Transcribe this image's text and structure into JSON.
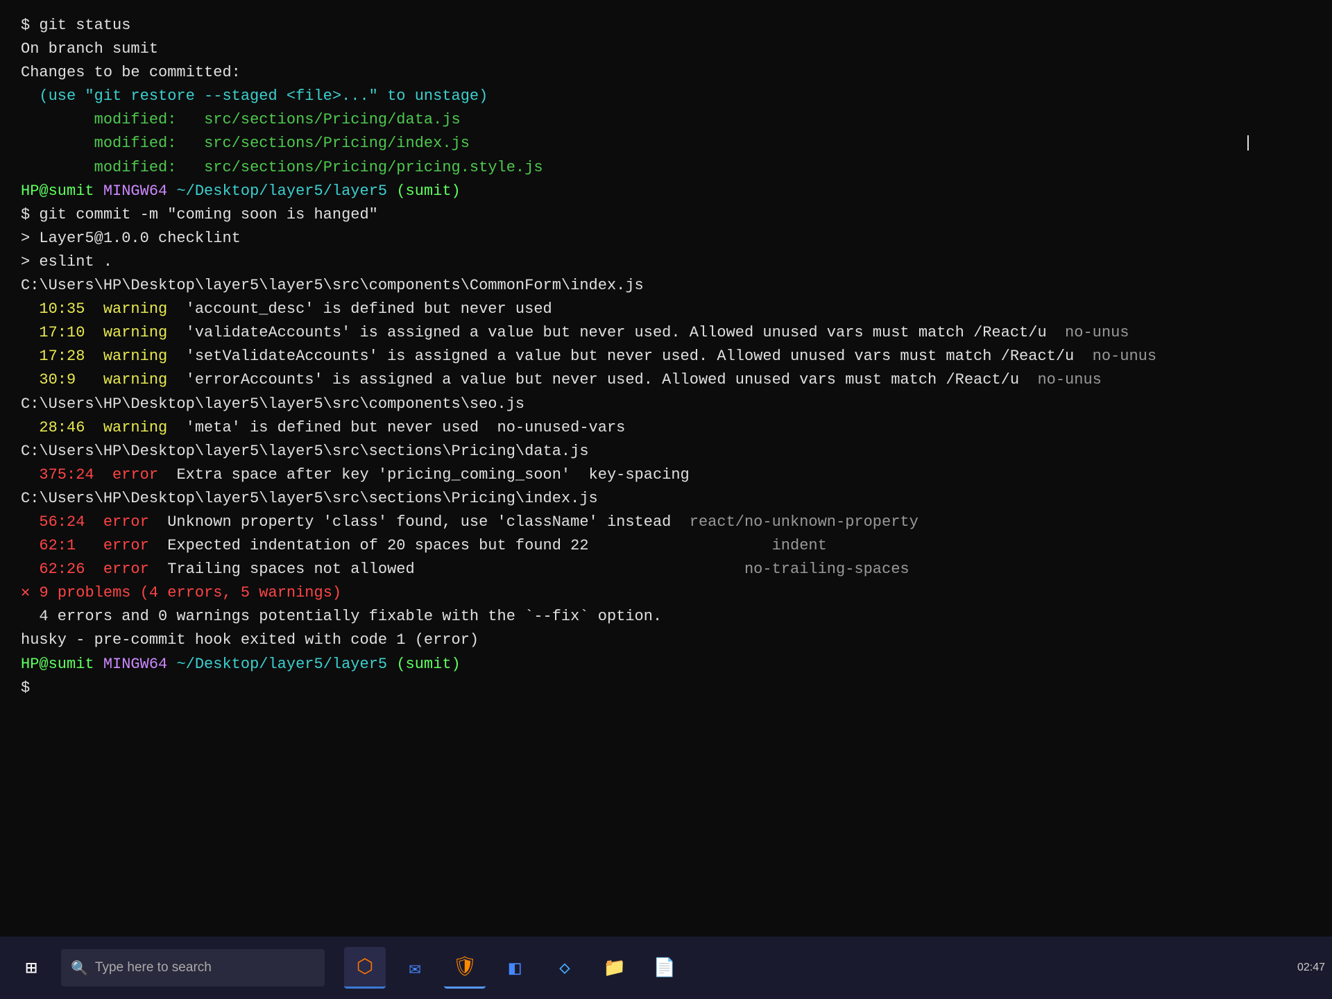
{
  "terminal": {
    "lines": [
      {
        "id": "git-status-cmd",
        "parts": [
          {
            "text": "$ git status",
            "class": "white"
          }
        ]
      },
      {
        "id": "branch-line",
        "parts": [
          {
            "text": "On branch sumit",
            "class": "white"
          }
        ]
      },
      {
        "id": "changes-line",
        "parts": [
          {
            "text": "Changes to be committed:",
            "class": "white"
          }
        ]
      },
      {
        "id": "unstage-hint",
        "parts": [
          {
            "text": "  (use \"git restore --staged <file>...\" to unstage)",
            "class": "cyan"
          }
        ]
      },
      {
        "id": "mod1",
        "parts": [
          {
            "text": "\t",
            "class": ""
          },
          {
            "text": "modified:   ",
            "class": "green"
          },
          {
            "text": "src/sections/Pricing/data.js",
            "class": "green"
          }
        ]
      },
      {
        "id": "mod2",
        "parts": [
          {
            "text": "\t",
            "class": ""
          },
          {
            "text": "modified:   ",
            "class": "green"
          },
          {
            "text": "src/sections/Pricing/index.js",
            "class": "green"
          }
        ]
      },
      {
        "id": "mod3",
        "parts": [
          {
            "text": "\t",
            "class": ""
          },
          {
            "text": "modified:   ",
            "class": "green"
          },
          {
            "text": "src/sections/Pricing/pricing.style.js",
            "class": "green"
          }
        ]
      },
      {
        "id": "blank1",
        "parts": [
          {
            "text": "",
            "class": ""
          }
        ]
      },
      {
        "id": "prompt1",
        "parts": [
          {
            "text": "HP@sumit ",
            "class": "bright-green"
          },
          {
            "text": "MINGW64 ",
            "class": "purple"
          },
          {
            "text": "~/Desktop/layer5/layer5 ",
            "class": "cyan"
          },
          {
            "text": "(sumit)",
            "class": "bright-green"
          }
        ]
      },
      {
        "id": "commit-cmd",
        "parts": [
          {
            "text": "$ git commit -m \"coming soon is hanged\"",
            "class": "white"
          }
        ]
      },
      {
        "id": "blank2",
        "parts": [
          {
            "text": "",
            "class": ""
          }
        ]
      },
      {
        "id": "layer5-checklint",
        "parts": [
          {
            "text": "> Layer5@1.0.0 checklint",
            "class": "white"
          }
        ]
      },
      {
        "id": "eslint-dot",
        "parts": [
          {
            "text": "> eslint .",
            "class": "white"
          }
        ]
      },
      {
        "id": "blank3",
        "parts": [
          {
            "text": "",
            "class": ""
          }
        ]
      },
      {
        "id": "file1",
        "parts": [
          {
            "text": "C:\\Users\\HP\\Desktop\\layer5\\layer5\\src\\components\\CommonForm\\index.js",
            "class": "white"
          }
        ]
      },
      {
        "id": "warn1",
        "parts": [
          {
            "text": "  10:35  warning  ",
            "class": "yellow"
          },
          {
            "text": "'account_desc' is defined but never used",
            "class": "white"
          }
        ]
      },
      {
        "id": "warn2",
        "parts": [
          {
            "text": "  17:10  warning  ",
            "class": "yellow"
          },
          {
            "text": "'validateAccounts' is assigned a value but never used. Allowed unused vars must match /React/u",
            "class": "white"
          },
          {
            "text": "  no-unus",
            "class": "gray"
          }
        ]
      },
      {
        "id": "warn3",
        "parts": [
          {
            "text": "  17:28  warning  ",
            "class": "yellow"
          },
          {
            "text": "'setValidateAccounts' is assigned a value but never used. Allowed unused vars must match /React/u",
            "class": "white"
          },
          {
            "text": "  no-unus",
            "class": "gray"
          }
        ]
      },
      {
        "id": "warn4",
        "parts": [
          {
            "text": "  30:9   warning  ",
            "class": "yellow"
          },
          {
            "text": "'errorAccounts' is assigned a value but never used. Allowed unused vars must match /React/u",
            "class": "white"
          },
          {
            "text": "  no-unus",
            "class": "gray"
          }
        ]
      },
      {
        "id": "blank4",
        "parts": [
          {
            "text": "",
            "class": ""
          }
        ]
      },
      {
        "id": "file2",
        "parts": [
          {
            "text": "C:\\Users\\HP\\Desktop\\layer5\\layer5\\src\\components\\seo.js",
            "class": "white"
          }
        ]
      },
      {
        "id": "warn5",
        "parts": [
          {
            "text": "  28:46  warning  ",
            "class": "yellow"
          },
          {
            "text": "'meta' is defined but never used  no-unused-vars",
            "class": "white"
          }
        ]
      },
      {
        "id": "blank5",
        "parts": [
          {
            "text": "",
            "class": ""
          }
        ]
      },
      {
        "id": "file3",
        "parts": [
          {
            "text": "C:\\Users\\HP\\Desktop\\layer5\\layer5\\src\\sections\\Pricing\\data.js",
            "class": "white"
          }
        ]
      },
      {
        "id": "err1",
        "parts": [
          {
            "text": "  375:24  error  ",
            "class": "red"
          },
          {
            "text": "Extra space after key 'pricing_coming_soon'  key-spacing",
            "class": "white"
          }
        ]
      },
      {
        "id": "blank6",
        "parts": [
          {
            "text": "",
            "class": ""
          }
        ]
      },
      {
        "id": "file4",
        "parts": [
          {
            "text": "C:\\Users\\HP\\Desktop\\layer5\\layer5\\src\\sections\\Pricing\\index.js",
            "class": "white"
          }
        ]
      },
      {
        "id": "err2",
        "parts": [
          {
            "text": "  56:24  error  ",
            "class": "red"
          },
          {
            "text": "Unknown property 'class' found, use 'className' instead",
            "class": "white"
          },
          {
            "text": "  react/no-unknown-property",
            "class": "gray"
          }
        ]
      },
      {
        "id": "err3",
        "parts": [
          {
            "text": "  62:1   error  ",
            "class": "red"
          },
          {
            "text": "Expected indentation of 20 spaces but found 22",
            "class": "white"
          },
          {
            "text": "                    indent",
            "class": "gray"
          }
        ]
      },
      {
        "id": "err4",
        "parts": [
          {
            "text": "  62:26  error  ",
            "class": "red"
          },
          {
            "text": "Trailing spaces not allowed",
            "class": "white"
          },
          {
            "text": "                                    no-trailing-spaces",
            "class": "gray"
          }
        ]
      },
      {
        "id": "blank7",
        "parts": [
          {
            "text": "",
            "class": ""
          }
        ]
      },
      {
        "id": "summary",
        "parts": [
          {
            "text": "✕ 9 problems (4 errors, 5 warnings)",
            "class": "red"
          }
        ]
      },
      {
        "id": "fixable",
        "parts": [
          {
            "text": "  4 errors and 0 warnings potentially fixable with the `--fix` option.",
            "class": "white"
          }
        ]
      },
      {
        "id": "blank8",
        "parts": [
          {
            "text": "",
            "class": ""
          }
        ]
      },
      {
        "id": "husky",
        "parts": [
          {
            "text": "husky - pre-commit hook exited with code 1 (error)",
            "class": "white"
          }
        ]
      },
      {
        "id": "blank9",
        "parts": [
          {
            "text": "",
            "class": ""
          }
        ]
      },
      {
        "id": "prompt2",
        "parts": [
          {
            "text": "HP@sumit ",
            "class": "bright-green"
          },
          {
            "text": "MINGW64 ",
            "class": "purple"
          },
          {
            "text": "~/Desktop/layer5/layer5 ",
            "class": "cyan"
          },
          {
            "text": "(sumit)",
            "class": "bright-green"
          }
        ]
      },
      {
        "id": "prompt3",
        "parts": [
          {
            "text": "$ ",
            "class": "white"
          }
        ]
      }
    ]
  },
  "taskbar": {
    "search_placeholder": "Type here to search",
    "icons": [
      {
        "name": "windows-start",
        "symbol": "⊞",
        "class": ""
      },
      {
        "name": "git-bash",
        "symbol": "⊙",
        "class": "tb-git"
      },
      {
        "name": "mail",
        "symbol": "✉",
        "class": "tb-mail"
      },
      {
        "name": "shield",
        "symbol": "⛉",
        "class": "tb-shield"
      },
      {
        "name": "vscode",
        "symbol": "◧",
        "class": "tb-vscode"
      },
      {
        "name": "diamond",
        "symbol": "◇",
        "class": "tb-diamond"
      },
      {
        "name": "folder",
        "symbol": "🗁",
        "class": "tb-folder"
      },
      {
        "name": "file",
        "symbol": "🗋",
        "class": "tb-file"
      }
    ]
  }
}
